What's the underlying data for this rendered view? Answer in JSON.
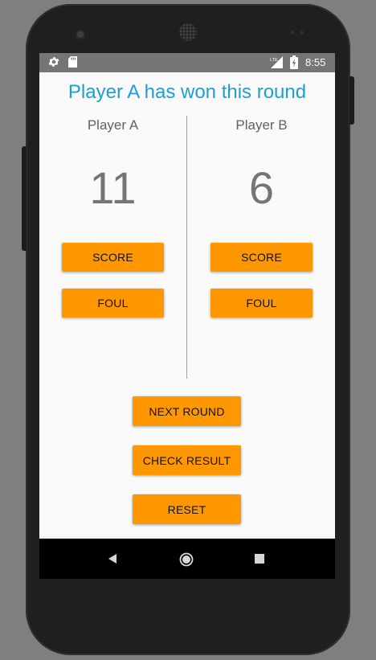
{
  "status_bar": {
    "time": "8:55",
    "icons": [
      "gear-icon",
      "sd-card-icon",
      "lte-signal-icon",
      "battery-charging-icon"
    ],
    "lte_label": "LTE"
  },
  "headline": "Player A has won this round",
  "players": [
    {
      "name": "Player A",
      "score": "11",
      "score_label": "SCORE",
      "foul_label": "FOUL"
    },
    {
      "name": "Player B",
      "score": "6",
      "score_label": "SCORE",
      "foul_label": "FOUL"
    }
  ],
  "actions": {
    "next_round": "NEXT ROUND",
    "check_result": "CHECK RESULT",
    "reset": "RESET"
  },
  "nav": {
    "icons": [
      "back-icon",
      "home-icon",
      "recent-apps-icon"
    ]
  },
  "colors": {
    "headline": "#1f9ed3",
    "button": "#ff9800",
    "status_bar": "#757575",
    "background": "#fafafa"
  }
}
